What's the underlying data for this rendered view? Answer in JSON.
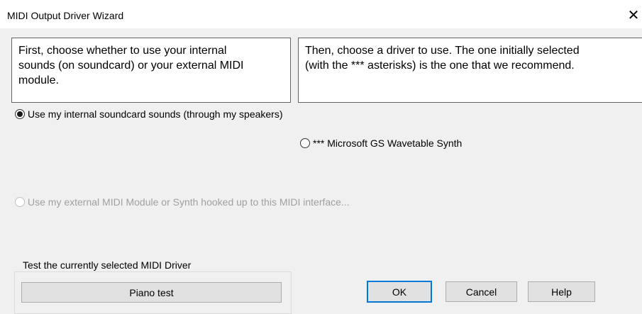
{
  "window": {
    "title": "MIDI Output Driver Wizard",
    "close_glyph": "✕"
  },
  "info": {
    "left_text": "First, choose whether to use your internal\nsounds (on soundcard) or your external MIDI\nmodule.",
    "right_text": "Then, choose a driver to use. The one initially selected\n(with the *** asterisks) is the one that we recommend."
  },
  "options": {
    "internal_label": "Use my internal soundcard sounds (through my speakers)",
    "internal_selected": true,
    "driver_label": "*** Microsoft GS Wavetable Synth",
    "driver_selected": false,
    "external_label": "Use my external MIDI Module or Synth hooked up to this MIDI interface...",
    "external_enabled": false
  },
  "test_group": {
    "label": "Test the currently selected MIDI Driver",
    "piano_button": "Piano test"
  },
  "buttons": {
    "ok": "OK",
    "cancel": "Cancel",
    "help": "Help"
  },
  "colors": {
    "dialog_bg": "#f0f0f0",
    "default_button_border": "#0078d7",
    "disabled_text": "#a0a0a0"
  }
}
